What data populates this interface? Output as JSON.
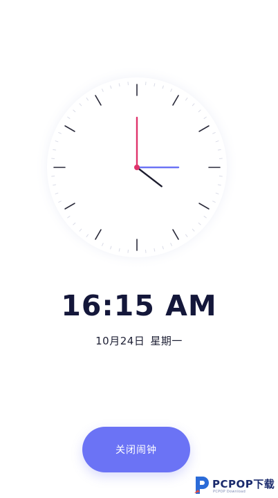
{
  "clock": {
    "hour": 4,
    "minute": 15,
    "second": 0,
    "hour_hand_color": "#1c1c2e",
    "minute_hand_color": "#e0336b",
    "second_hand_color": "#6b73f5",
    "tick_color": "#2a2a3a"
  },
  "display": {
    "time": "16:15 AM",
    "date": "10月24日",
    "weekday": "星期一"
  },
  "actions": {
    "dismiss_label": "关闭闹钟",
    "accent_color": "#6b73f5"
  },
  "watermark": {
    "brand": "PCPOP下载",
    "tagline": "PCPOP Download"
  }
}
